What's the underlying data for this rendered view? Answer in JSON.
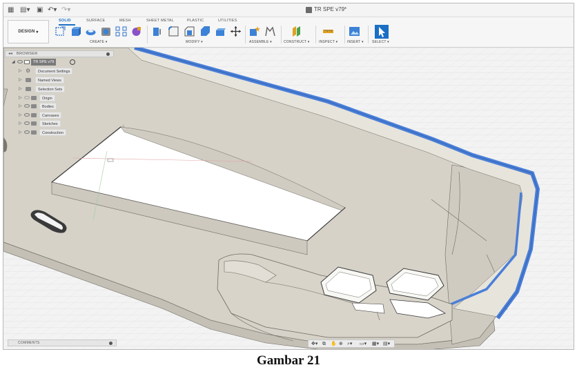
{
  "app": {
    "document_title": "TR SPE v79*",
    "design_button": "DESIGN",
    "tabs": [
      "SOLID",
      "SURFACE",
      "MESH",
      "SHEET METAL",
      "PLASTIC",
      "UTILITIES"
    ],
    "groups": [
      "CREATE",
      "MODIFY",
      "ASSEMBLE",
      "CONSTRUCT",
      "INSPECT",
      "INSERT",
      "SELECT"
    ]
  },
  "browser": {
    "title": "BROWSER",
    "root": "TR SPE v79",
    "items": [
      "Document Settings",
      "Named Views",
      "Selection Sets",
      "Origin",
      "Bodies",
      "Canvases",
      "Sketches",
      "Construction"
    ]
  },
  "comments": {
    "label": "COMMENTS"
  },
  "caption": "Gambar 21",
  "colors": {
    "accent": "#1b6fc4",
    "body": "#d6d2c8",
    "highlight": "#4a7fd8"
  },
  "icons": [
    "grid-icon",
    "file-icon",
    "save-icon",
    "undo-icon",
    "redo-icon",
    "orbit-icon",
    "pan-icon",
    "zoom-icon",
    "display-icon",
    "grid-toggle-icon",
    "view-icon"
  ]
}
